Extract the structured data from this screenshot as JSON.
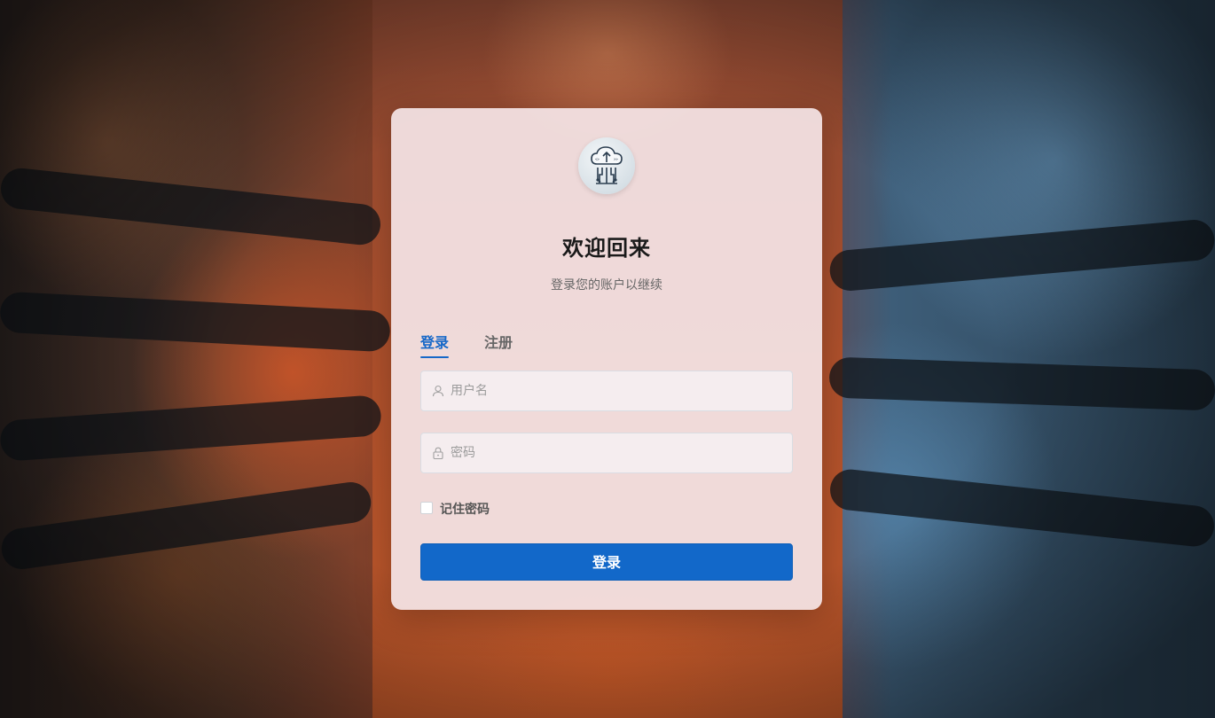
{
  "login_card": {
    "title": "欢迎回来",
    "subtitle": "登录您的账户以继续",
    "logo_icon": "cloud-upload-circuit-icon"
  },
  "tabs": [
    {
      "label": "登录",
      "active": true
    },
    {
      "label": "注册",
      "active": false
    }
  ],
  "form": {
    "username": {
      "placeholder": "用户名",
      "value": "",
      "icon": "user-icon"
    },
    "password": {
      "placeholder": "密码",
      "value": "",
      "icon": "lock-icon"
    },
    "remember": {
      "label": "记住密码",
      "checked": false
    },
    "submit_label": "登录"
  },
  "colors": {
    "accent": "#1268c9",
    "card_bg": "#f4e4e6"
  }
}
